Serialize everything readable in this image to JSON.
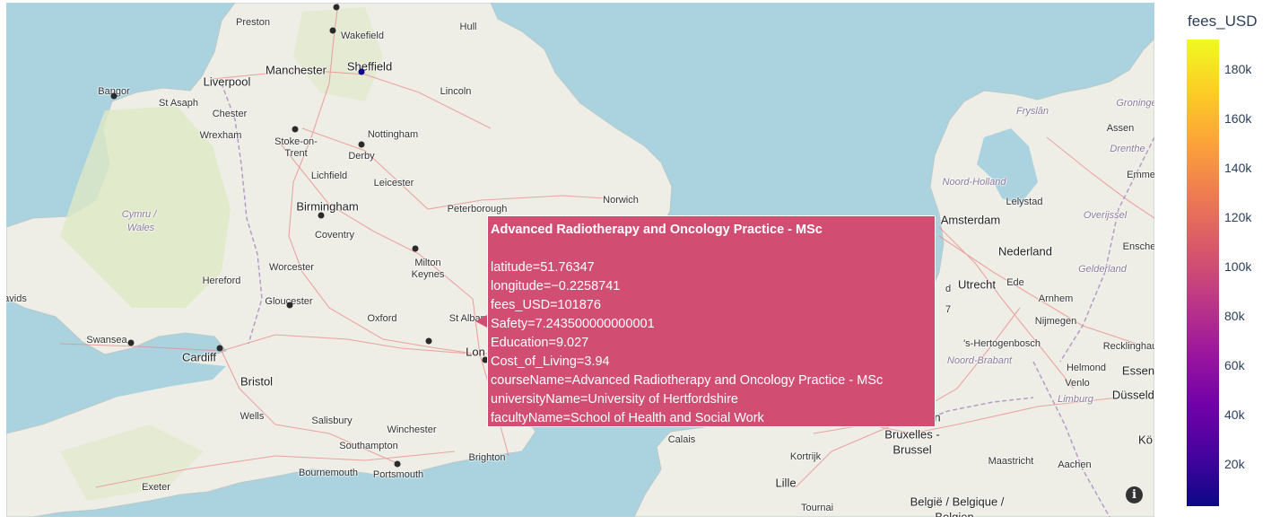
{
  "map": {
    "places": [
      {
        "name": "Preston",
        "cls": ""
      },
      {
        "name": "Hull",
        "cls": ""
      },
      {
        "name": "Wakefield",
        "cls": ""
      },
      {
        "name": "Manchester",
        "cls": "big"
      },
      {
        "name": "Sheffield",
        "cls": "big"
      },
      {
        "name": "Liverpool",
        "cls": "big"
      },
      {
        "name": "Bangor",
        "cls": ""
      },
      {
        "name": "St Asaph",
        "cls": ""
      },
      {
        "name": "Lincoln",
        "cls": ""
      },
      {
        "name": "Chester",
        "cls": ""
      },
      {
        "name": "Wrexham",
        "cls": ""
      },
      {
        "name": "Stoke-on-",
        "cls": ""
      },
      {
        "name": "Trent",
        "cls": ""
      },
      {
        "name": "Nottingham",
        "cls": ""
      },
      {
        "name": "Derby",
        "cls": ""
      },
      {
        "name": "Lichfield",
        "cls": ""
      },
      {
        "name": "Leicester",
        "cls": ""
      },
      {
        "name": "Birmingham",
        "cls": "big"
      },
      {
        "name": "Peterborough",
        "cls": ""
      },
      {
        "name": "Norwich",
        "cls": ""
      },
      {
        "name": "Cymru /",
        "cls": "region"
      },
      {
        "name": "Wales",
        "cls": "region"
      },
      {
        "name": "Coventry",
        "cls": ""
      },
      {
        "name": "Milton",
        "cls": ""
      },
      {
        "name": "Keynes",
        "cls": ""
      },
      {
        "name": "Worcester",
        "cls": ""
      },
      {
        "name": "Hereford",
        "cls": ""
      },
      {
        "name": "avids",
        "cls": ""
      },
      {
        "name": "Gloucester",
        "cls": ""
      },
      {
        "name": "Oxford",
        "cls": ""
      },
      {
        "name": "St Albans",
        "cls": ""
      },
      {
        "name": "Swansea",
        "cls": ""
      },
      {
        "name": "Cardiff",
        "cls": "big"
      },
      {
        "name": "Lon",
        "cls": "big"
      },
      {
        "name": "Bristol",
        "cls": "big"
      },
      {
        "name": "Wells",
        "cls": ""
      },
      {
        "name": "Salisbury",
        "cls": ""
      },
      {
        "name": "Winchester",
        "cls": ""
      },
      {
        "name": "Southampton",
        "cls": ""
      },
      {
        "name": "Bournemouth",
        "cls": ""
      },
      {
        "name": "Portsmouth",
        "cls": ""
      },
      {
        "name": "Brighton",
        "cls": ""
      },
      {
        "name": "Exeter",
        "cls": ""
      },
      {
        "name": "Calais",
        "cls": ""
      },
      {
        "name": "Kortrijk",
        "cls": ""
      },
      {
        "name": "Lille",
        "cls": "big"
      },
      {
        "name": "Tournai",
        "cls": ""
      },
      {
        "name": "Bruxelles -",
        "cls": "big"
      },
      {
        "name": "Brussel",
        "cls": "big"
      },
      {
        "name": "België / Belgique /",
        "cls": "big"
      },
      {
        "name": "Belgien",
        "cls": "big"
      },
      {
        "name": "n",
        "cls": "big"
      },
      {
        "name": "Maastricht",
        "cls": ""
      },
      {
        "name": "Aachen",
        "cls": ""
      },
      {
        "name": "Amsterdam",
        "cls": "big"
      },
      {
        "name": "Nederland",
        "cls": "big"
      },
      {
        "name": "Utrecht",
        "cls": "big"
      },
      {
        "name": "Ede",
        "cls": ""
      },
      {
        "name": "Arnhem",
        "cls": ""
      },
      {
        "name": "Nijmegen",
        "cls": ""
      },
      {
        "name": "'s-Hertogenbosch",
        "cls": ""
      },
      {
        "name": "Noord-Brabant",
        "cls": "region"
      },
      {
        "name": "Helmond",
        "cls": ""
      },
      {
        "name": "Venlo",
        "cls": ""
      },
      {
        "name": "Limburg",
        "cls": "region"
      },
      {
        "name": "Gelderland",
        "cls": "region"
      },
      {
        "name": "Noord-Holland",
        "cls": "region"
      },
      {
        "name": "Lelystad",
        "cls": ""
      },
      {
        "name": "Overijssel",
        "cls": "region"
      },
      {
        "name": "Fryslân",
        "cls": "region"
      },
      {
        "name": "Groninge",
        "cls": "region"
      },
      {
        "name": "Assen",
        "cls": ""
      },
      {
        "name": "Drenthe",
        "cls": "region"
      },
      {
        "name": "Emme",
        "cls": ""
      },
      {
        "name": "Ensche",
        "cls": ""
      },
      {
        "name": "Recklinghau",
        "cls": ""
      },
      {
        "name": "Essen",
        "cls": "big"
      },
      {
        "name": "Düsseldo",
        "cls": "big"
      },
      {
        "name": "Kö",
        "cls": "big"
      },
      {
        "name": "d",
        "cls": ""
      },
      {
        "name": "7",
        "cls": ""
      }
    ]
  },
  "tooltip": {
    "title": "Advanced Radiotherapy and Oncology Practice - MSc",
    "lines": [
      "latitude=51.76347",
      "longitude=−0.2258741",
      "fees_USD=101876",
      "Safety=7.243500000000001",
      "Education=9.027",
      "Cost_of_Living=3.94",
      "courseName=Advanced Radiotherapy and Oncology Practice - MSc",
      "universityName=University of Hertfordshire",
      "facultyName=School of Health and Social Work"
    ]
  },
  "colorbar": {
    "title": "fees_USD",
    "ticks": [
      "180k",
      "160k",
      "140k",
      "120k",
      "100k",
      "80k",
      "60k",
      "40k",
      "20k"
    ],
    "tick_values": [
      180000,
      160000,
      140000,
      120000,
      100000,
      80000,
      60000,
      40000,
      20000
    ],
    "range": [
      3000,
      192000
    ],
    "colorscale": [
      "#0d0887",
      "#46039f",
      "#7201a8",
      "#9c179e",
      "#bd3786",
      "#d8576b",
      "#ed7953",
      "#fb9f3a",
      "#fdca26",
      "#f0f921"
    ]
  },
  "info_icon": "info-icon"
}
